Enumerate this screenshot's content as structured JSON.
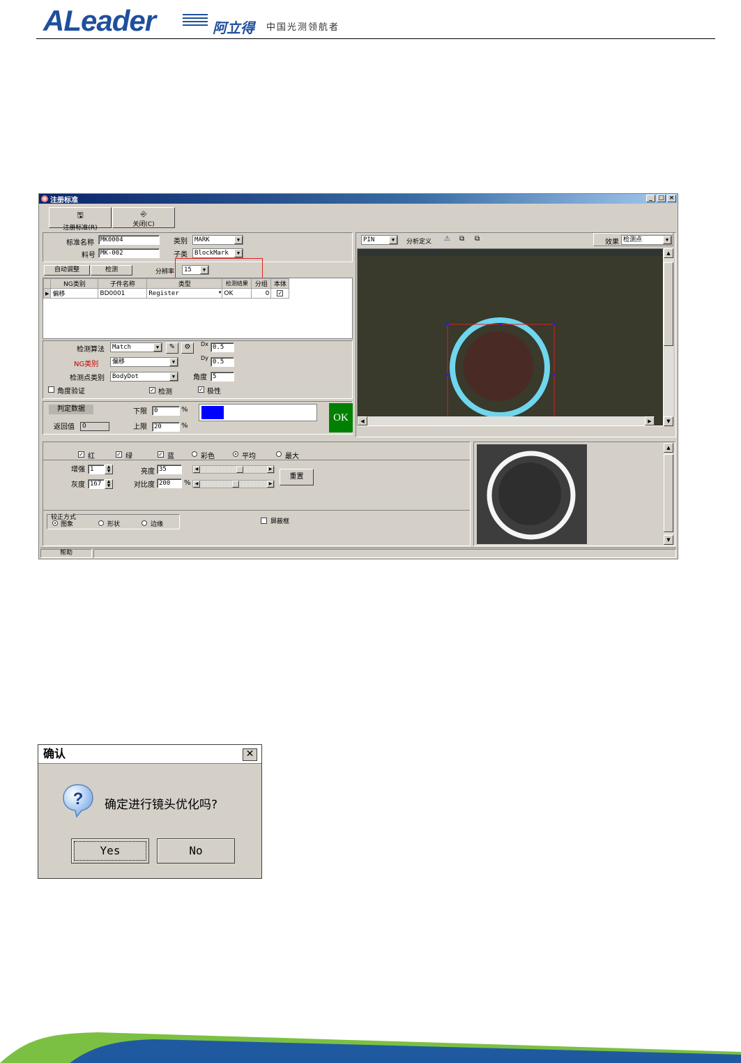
{
  "header": {
    "logo": "ALeader",
    "logo_cn": "阿立得",
    "tagline": "中国光测领航者"
  },
  "window": {
    "title": "注册标准",
    "toolbar": {
      "register": "注册标准(R)",
      "close": "关闭(C)"
    },
    "form": {
      "std_name_label": "标准名称",
      "std_name": "MK0004",
      "category_label": "类别",
      "category": "MARK",
      "part_no_label": "料号",
      "part_no": "MK-002",
      "subclass_label": "子类",
      "subclass": "BlockMark"
    },
    "tabs": {
      "auto_adjust": "自动调整",
      "detect": "检测",
      "resolution_label": "分辨率",
      "resolution": "15"
    },
    "table": {
      "headers": [
        "NG类别",
        "子件名称",
        "类型",
        "检测结果",
        "分组",
        "本体"
      ],
      "rows": [
        {
          "ng": "偏移",
          "name": "BD0001",
          "type": "Register",
          "result": "OK",
          "group": "0",
          "body": "✓"
        }
      ]
    },
    "algo": {
      "algo_label": "检测算法",
      "algo": "Match",
      "ng_label": "NG类别",
      "ng": "偏移",
      "point_label": "检测点类别",
      "point": "BodyDot",
      "dx_label": "Dx",
      "dx": "0.5",
      "dy_label": "Dy",
      "dy": "0.5",
      "angle_label": "角度",
      "angle": "5",
      "angle_verify": "角度验证",
      "detect": "检测",
      "polarity": "极性"
    },
    "judge": {
      "data_label": "判定数据",
      "lower_label": "下限",
      "lower": "0",
      "pct": "%",
      "return_label": "返回值",
      "return": "0",
      "upper_label": "上限",
      "upper": "20",
      "result": "OK"
    },
    "view": {
      "pin": "PIN",
      "analysis": "分析定义",
      "effect_label": "效果",
      "effect": "检测点"
    },
    "color": {
      "red": "红",
      "green": "绿",
      "blue": "蓝",
      "color": "彩色",
      "avg": "平均",
      "max": "最大",
      "enhance_label": "增强",
      "enhance": "1",
      "gray_label": "灰度",
      "gray": "167",
      "bright_label": "亮度",
      "bright": "35",
      "contrast_label": "对比度",
      "contrast": "200",
      "pct": "%",
      "reset": "重置"
    },
    "correction": {
      "title": "较正方式",
      "image": "图象",
      "shape": "形状",
      "edge": "边缘",
      "mask": "屏蔽框"
    },
    "status": {
      "help": "帮助"
    }
  },
  "dialog": {
    "title": "确认",
    "message": "确定进行镜头优化吗?",
    "yes": "Yes",
    "no": "No"
  }
}
